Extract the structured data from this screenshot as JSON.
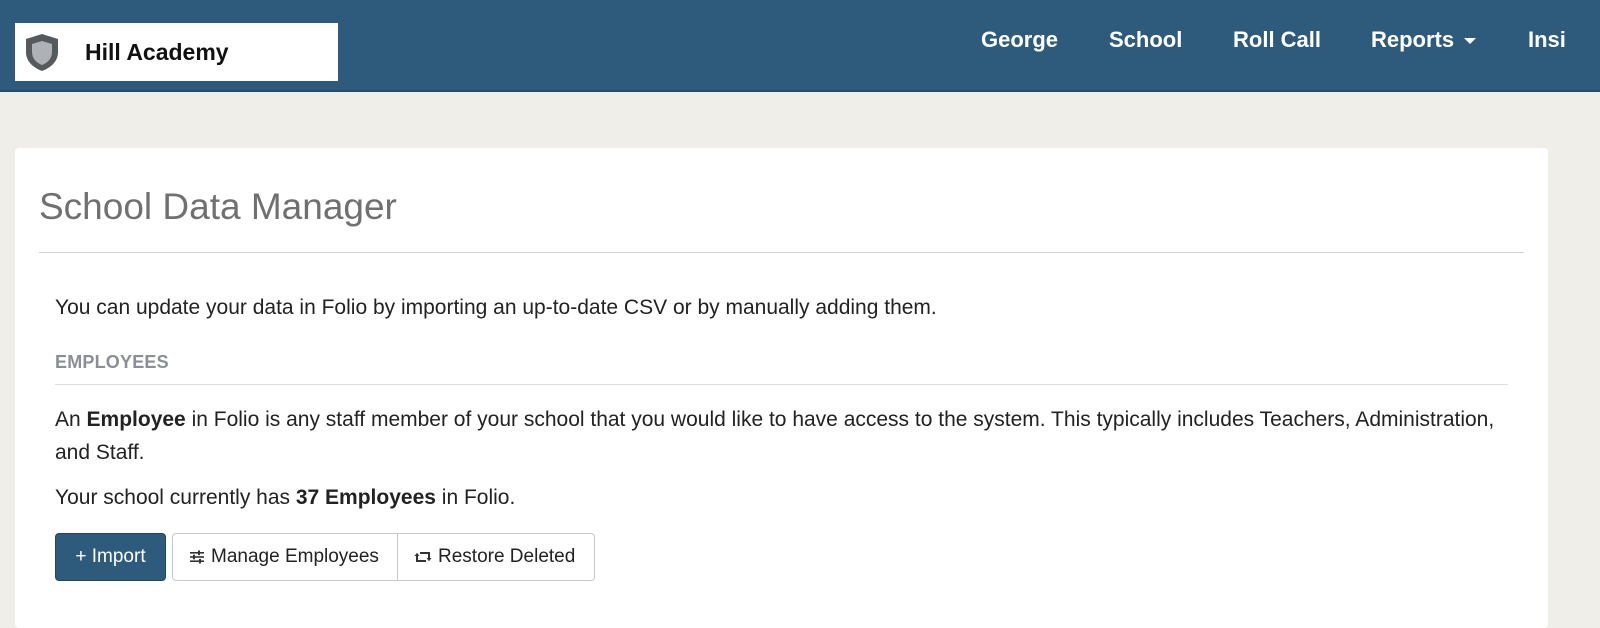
{
  "brand": {
    "name": "Hill Academy",
    "icon": "shield-icon"
  },
  "nav": {
    "items": [
      {
        "label": "George"
      },
      {
        "label": "School"
      },
      {
        "label": "Roll Call"
      },
      {
        "label": "Reports",
        "icon": "caret-down-icon"
      },
      {
        "label": "Insi"
      }
    ]
  },
  "colors": {
    "primary": "#2e5b7b",
    "background": "#efeee8",
    "heading_gray": "#707070",
    "section_gray": "#8b8e97"
  },
  "page": {
    "title": "School Data Manager",
    "intro": "You can update your data in Folio by importing an up-to-date CSV or by manually adding them."
  },
  "employees": {
    "heading": "EMPLOYEES",
    "desc_prefix": "An ",
    "desc_bold": "Employee",
    "desc_suffix": " in Folio is any staff member of your school that you would like to have access to the system. This typically includes Teachers, Administration, and Staff.",
    "count_prefix": "Your school currently has ",
    "count_bold": "37 Employees",
    "count_suffix": " in Folio.",
    "buttons": {
      "import_label": "+ Import",
      "manage_label": "Manage Employees",
      "manage_icon": "sliders-icon",
      "restore_label": "Restore Deleted",
      "restore_icon": "retweet-icon"
    }
  }
}
